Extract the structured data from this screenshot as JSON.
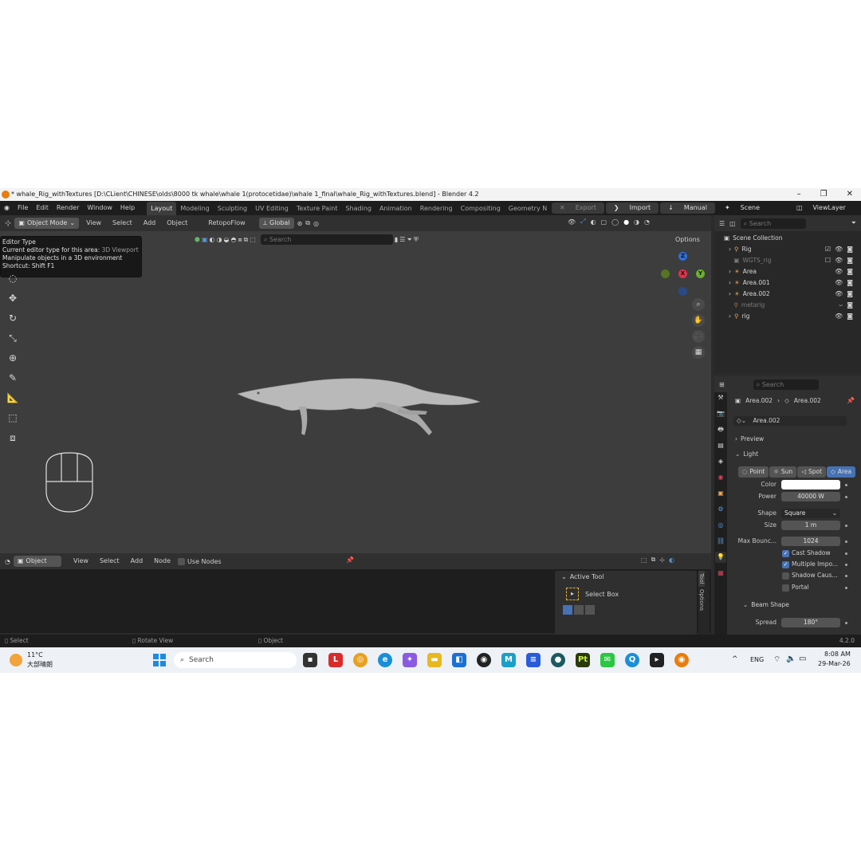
{
  "window": {
    "title": "* whale_Rig_withTextures [D:\\CLient\\CHINESE\\olds\\8000 tk whale\\whale 1(protocetidae)\\whale 1_final\\whale_Rig_withTextures.blend] - Blender 4.2",
    "minimize": "–",
    "maximize": "❐",
    "close": "✕"
  },
  "menubar": {
    "items": [
      "File",
      "Edit",
      "Render",
      "Window",
      "Help"
    ],
    "workspaces": [
      "Layout",
      "Modeling",
      "Sculpting",
      "UV Editing",
      "Texture Paint",
      "Shading",
      "Animation",
      "Rendering",
      "Compositing",
      "Geometry N"
    ],
    "export_label": "Export",
    "import_label": "Import",
    "manual_label": "Manual",
    "scene_label": "Scene",
    "viewlayer_label": "ViewLayer"
  },
  "viewport_header": {
    "mode": "Object Mode",
    "menus": [
      "View",
      "Select",
      "Add",
      "Object"
    ],
    "addon": "RetopoFlow",
    "orientation": "Global",
    "search_placeholder": "Search",
    "options_label": "Options"
  },
  "tooltip": {
    "title": "Editor Type",
    "line1_label": "Current editor type for this area:",
    "line1_value": "3D Viewport",
    "line2": "Manipulate objects in a 3D environment",
    "shortcut": "Shortcut: Shift F1"
  },
  "gizmo": {
    "z": "Z",
    "x": "X",
    "y": "Y"
  },
  "node_editor": {
    "type": "Object",
    "menus": [
      "View",
      "Select",
      "Add",
      "Node"
    ],
    "use_nodes": "Use Nodes",
    "active_tool_title": "Active Tool",
    "select_box": "Select Box",
    "tab_tool": "Tool",
    "tab_options": "Options"
  },
  "statusbar": {
    "select": "Select",
    "rotate": "Rotate View",
    "object": "Object",
    "version": "4.2.0"
  },
  "outliner": {
    "search_placeholder": "Search",
    "collection": "Scene Collection",
    "items": [
      {
        "name": "Rig",
        "dim": false
      },
      {
        "name": "WGTS_rig",
        "dim": true
      },
      {
        "name": "Area",
        "dim": false
      },
      {
        "name": "Area.001",
        "dim": false
      },
      {
        "name": "Area.002",
        "dim": false
      },
      {
        "name": "metarig",
        "dim": true
      },
      {
        "name": "rig",
        "dim": false
      }
    ]
  },
  "properties": {
    "search_placeholder": "Search",
    "breadcrumb_obj": "Area.002",
    "breadcrumb_data": "Area.002",
    "datablock": "Area.002",
    "preview_label": "Preview",
    "light_label": "Light",
    "light_types": [
      "Point",
      "Sun",
      "Spot",
      "Area"
    ],
    "color_label": "Color",
    "color_value": "#ffffff",
    "power_label": "Power",
    "power_value": "40000 W",
    "shape_label": "Shape",
    "shape_value": "Square",
    "size_label": "Size",
    "size_value": "1 m",
    "bounces_label": "Max Bounc...",
    "bounces_value": "1024",
    "cast_shadow": "Cast Shadow",
    "multiple_importance": "Multiple Impo...",
    "shadow_caustics": "Shadow Caus...",
    "portal": "Portal",
    "beam_shape_label": "Beam Shape",
    "spread_label": "Spread",
    "spread_value": "180°"
  },
  "taskbar": {
    "temperature": "11°C",
    "weather": "大部晴朗",
    "search_placeholder": "Search",
    "lang": "ENG",
    "time": "8:08 AM",
    "date": "29-Mar-26"
  }
}
